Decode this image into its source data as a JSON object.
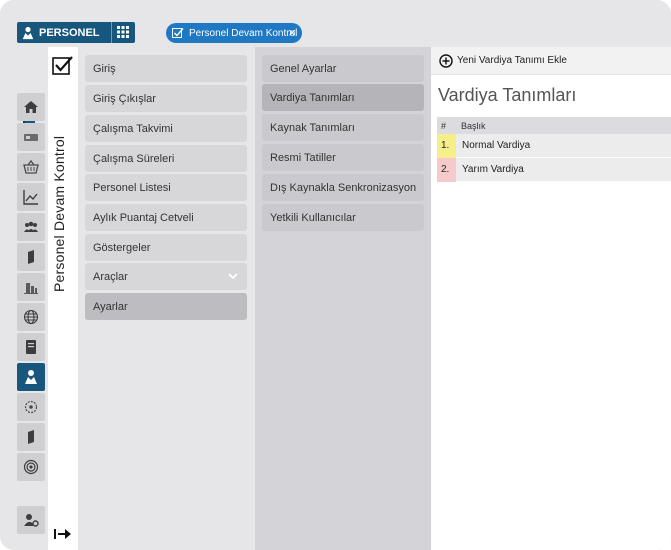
{
  "header": {
    "module_label": "PERSONEL",
    "active_tab": "Personel Devam Kontrol",
    "tab_close": "×"
  },
  "sidebar": {
    "vertical_title": "Personel Devam Kontrol",
    "icons": [
      "home-icon",
      "card-icon",
      "basket-icon",
      "chart-icon",
      "people-icon",
      "book-icon",
      "buildings-icon",
      "globe-icon",
      "notebook-icon",
      "person-icon",
      "recycle-icon",
      "book-icon",
      "target-icon",
      "users-settings-icon"
    ]
  },
  "menu": {
    "primary": [
      "Giriş",
      "Giriş Çıkışlar",
      "Çalışma Takvimi",
      "Çalışma Süreleri",
      "Personel Listesi",
      "Aylık Puantaj Cetveli",
      "Göstergeler",
      "Araçlar",
      "Ayarlar"
    ],
    "secondary": [
      "Genel Ayarlar",
      "Vardiya Tanımları",
      "Kaynak Tanımları",
      "Resmi Tatiller",
      "Dış Kaynakla Senkronizasyon",
      "Yetkili Kullanıcılar"
    ]
  },
  "panel": {
    "add_label": "Yeni Vardiya Tanımı Ekle",
    "title": "Vardiya Tanımları",
    "columns": [
      "#",
      "Başlık"
    ],
    "rows": [
      {
        "num": "1.",
        "label": "Normal Vardiya",
        "color": "#f5ee8a"
      },
      {
        "num": "2.",
        "label": "Yarım Vardiya",
        "color": "#f6c9cb"
      }
    ]
  },
  "colors": {
    "accent": "#17577d",
    "tab": "#1e78c4"
  }
}
